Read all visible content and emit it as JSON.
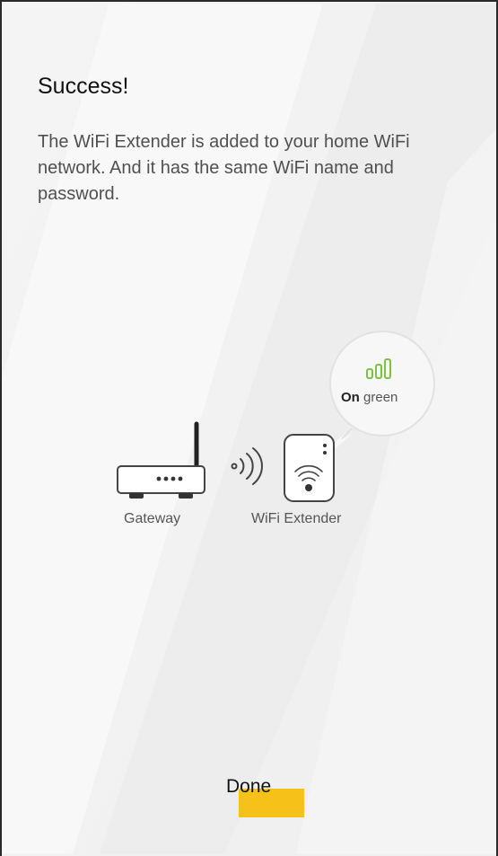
{
  "header": {
    "title": "Success!",
    "message": "The WiFi Extender is added to your home WiFi network. And it has the same WiFi name and password."
  },
  "diagram": {
    "gateway_label": "Gateway",
    "extender_label": "WiFi Extender",
    "status_prefix": "On",
    "status_suffix": "green",
    "led_icon": "signal-bars-icon",
    "accent_color": "#7cc242"
  },
  "footer": {
    "done_label": "Done",
    "highlight_color": "#f6c21a"
  }
}
